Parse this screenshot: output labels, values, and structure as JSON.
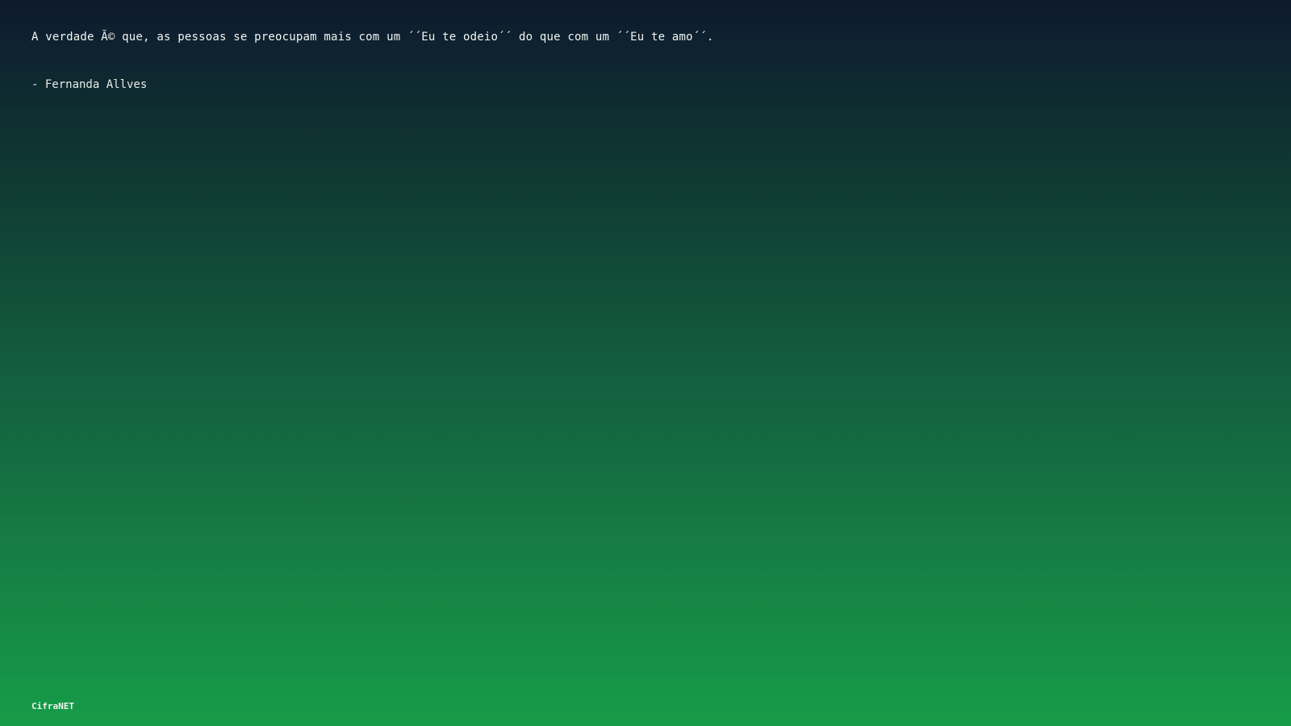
{
  "quote": {
    "text": "A verdade Ă© que, as pessoas se preocupam mais com um ´´Eu te odeio´´ do que com um ´´Eu te amo´´.",
    "author": "- Fernanda Allves"
  },
  "footer": {
    "brand": "CifraNET"
  },
  "colors": {
    "gradient_top": "#0e1a2e",
    "gradient_bottom": "#169c48",
    "text": "#f2f5f2"
  }
}
